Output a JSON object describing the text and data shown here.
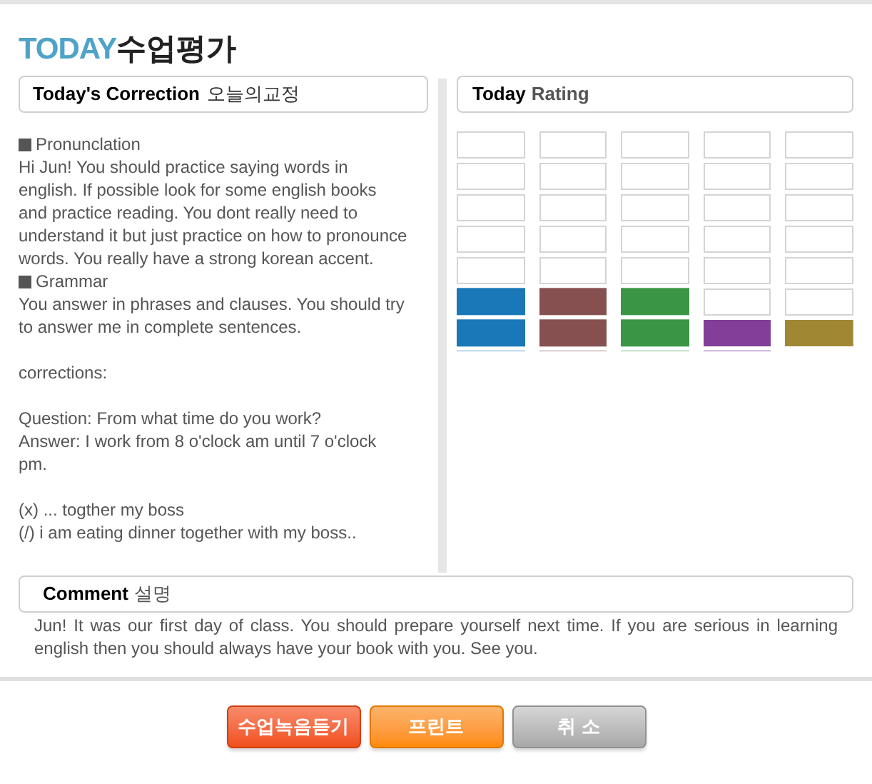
{
  "title": {
    "brand": "TODAY",
    "text": "수업평가"
  },
  "correction": {
    "heading": "Today's Correction",
    "heading_ko": "오늘의교정",
    "lines": [
      {
        "kind": "section",
        "text": "Pronunclation"
      },
      {
        "kind": "text",
        "text": "Hi Jun! You should practice saying words in english. If possible look for some english books and practice reading. You dont really need to understand it but just practice on how to pronounce words. You really have a strong korean accent."
      },
      {
        "kind": "section",
        "text": "Grammar"
      },
      {
        "kind": "text",
        "text": "You answer in phrases and clauses. You should try to answer me in complete sentences."
      },
      {
        "kind": "blank"
      },
      {
        "kind": "text",
        "text": "corrections:"
      },
      {
        "kind": "blank"
      },
      {
        "kind": "text",
        "text": "Question: From what time do you work?"
      },
      {
        "kind": "text",
        "text": "Answer: I work from 8 o'clock am until 7 o'clock pm."
      },
      {
        "kind": "blank"
      },
      {
        "kind": "text",
        "text": "(x) ... togther my boss"
      },
      {
        "kind": "text",
        "text": "(/) i am eating dinner together with my boss.."
      }
    ]
  },
  "rating": {
    "heading": "Today",
    "heading_rest": "Rating",
    "bars": [
      {
        "color": "#1a78b8",
        "level": 0.29
      },
      {
        "color": "#875050",
        "level": 0.29
      },
      {
        "color": "#3a9645",
        "level": 0.29
      },
      {
        "color": "#823e98",
        "level": 0.14
      },
      {
        "color": "#a08734",
        "level": 0.14
      }
    ]
  },
  "comment": {
    "heading": "Comment",
    "heading_ko": "설명",
    "text": "Jun! It was our first day of class. You should prepare yourself next time. If you are serious in learning english then you should always have your book with you. See you."
  },
  "buttons": [
    {
      "kind": "red",
      "label": "수업녹음듣기"
    },
    {
      "kind": "orange",
      "label": "프린트"
    },
    {
      "kind": "gray",
      "label": "취 소"
    }
  ]
}
